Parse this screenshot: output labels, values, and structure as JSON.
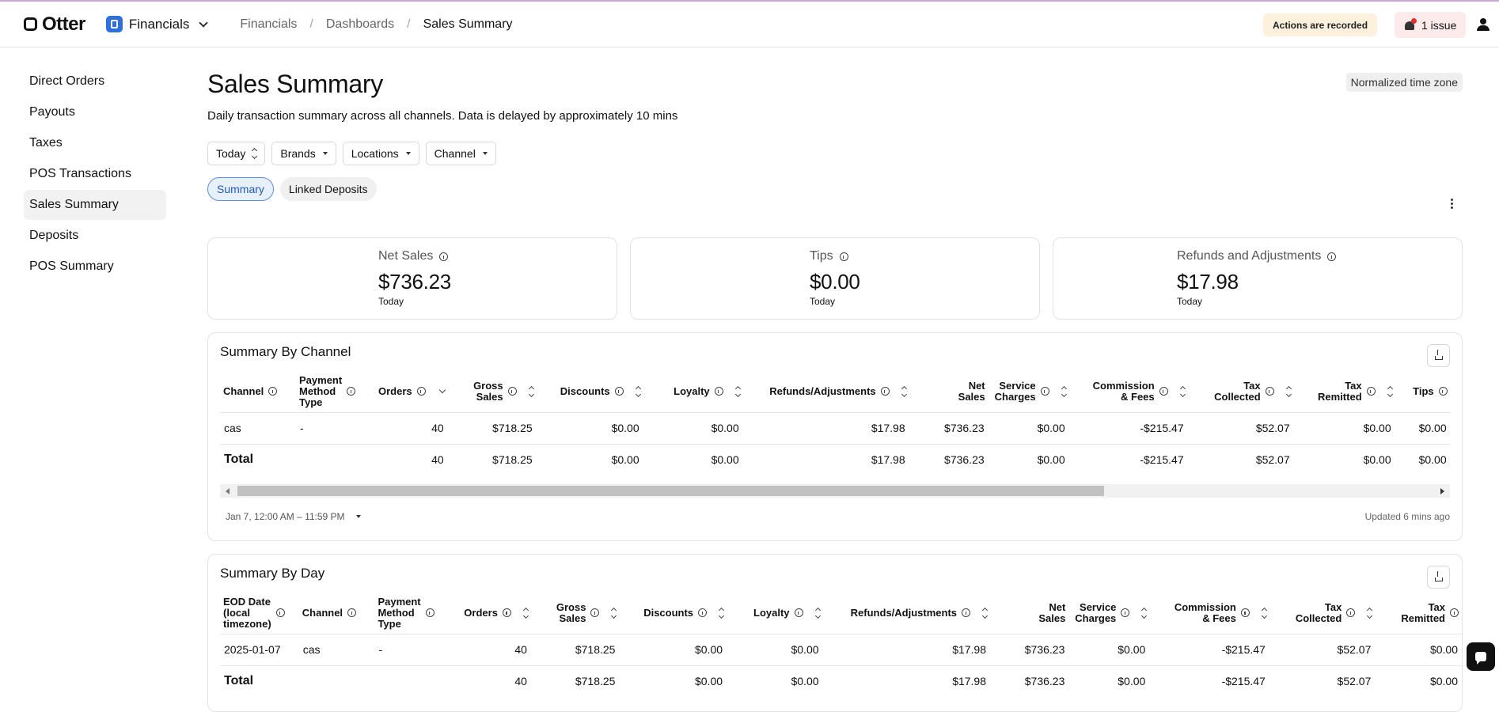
{
  "app": {
    "logo": "Otter",
    "section": "Financials"
  },
  "breadcrumbs": [
    "Financials",
    "/",
    "Dashboards",
    "/",
    "Sales Summary"
  ],
  "header": {
    "recorded": "Actions are recorded",
    "issues": "1 issue"
  },
  "sidebar": {
    "items": [
      {
        "label": "Direct Orders"
      },
      {
        "label": "Payouts"
      },
      {
        "label": "Taxes"
      },
      {
        "label": "POS Transactions"
      },
      {
        "label": "Sales Summary"
      },
      {
        "label": "Deposits"
      },
      {
        "label": "POS Summary"
      }
    ]
  },
  "page": {
    "title": "Sales Summary",
    "subtitle": "Daily transaction summary across all channels. Data is delayed by approximately 10 mins",
    "timezone_badge": "Normalized time zone"
  },
  "filters": {
    "date": "Today",
    "brands": "Brands",
    "locations": "Locations",
    "channel": "Channel"
  },
  "tabs": {
    "summary": "Summary",
    "linked": "Linked Deposits"
  },
  "cards": [
    {
      "label": "Net Sales",
      "value": "$736.23",
      "period": "Today"
    },
    {
      "label": "Tips",
      "value": "$0.00",
      "period": "Today"
    },
    {
      "label": "Refunds and Adjustments",
      "value": "$17.98",
      "period": "Today"
    }
  ],
  "by_channel": {
    "title": "Summary By Channel",
    "headers": {
      "channel": "Channel",
      "pmt1": "Payment",
      "pmt2": "Method",
      "pmt3": "Type",
      "orders": "Orders",
      "gross1": "Gross",
      "gross2": "Sales",
      "discounts": "Discounts",
      "loyalty": "Loyalty",
      "refunds": "Refunds/Adjustments",
      "net1": "Net",
      "net2": "Sales",
      "svc1": "Service",
      "svc2": "Charges",
      "comm1": "Commission",
      "comm2": "& Fees",
      "taxc1": "Tax",
      "taxc2": "Collected",
      "taxr1": "Tax",
      "taxr2": "Remitted",
      "tips": "Tips"
    },
    "row": {
      "channel": "cas",
      "pmt": "-",
      "orders": "40",
      "gross": "$718.25",
      "discounts": "$0.00",
      "loyalty": "$0.00",
      "refunds": "$17.98",
      "net": "$736.23",
      "svc": "$0.00",
      "comm": "-$215.47",
      "taxc": "$52.07",
      "taxr": "$0.00",
      "tips": "$0.00"
    },
    "total": {
      "label": "Total",
      "orders": "40",
      "gross": "$718.25",
      "discounts": "$0.00",
      "loyalty": "$0.00",
      "refunds": "$17.98",
      "net": "$736.23",
      "svc": "$0.00",
      "comm": "-$215.47",
      "taxc": "$52.07",
      "taxr": "$0.00",
      "tips": "$0.00"
    },
    "range": "Jan 7, 12:00 AM – 11:59 PM",
    "updated": "Updated 6 mins ago"
  },
  "by_day": {
    "title": "Summary By Day",
    "headers": {
      "eod1": "EOD Date",
      "eod2": "(local",
      "eod3": "timezone)",
      "channel": "Channel",
      "pmt1": "Payment",
      "pmt2": "Method",
      "pmt3": "Type",
      "orders": "Orders",
      "gross1": "Gross",
      "gross2": "Sales",
      "discounts": "Discounts",
      "loyalty": "Loyalty",
      "refunds": "Refunds/Adjustments",
      "net1": "Net",
      "net2": "Sales",
      "svc1": "Service",
      "svc2": "Charges",
      "comm1": "Commission",
      "comm2": "& Fees",
      "taxc1": "Tax",
      "taxc2": "Collected",
      "taxr1": "Tax",
      "taxr2": "Remitted"
    },
    "row": {
      "date": "2025-01-07",
      "channel": "cas",
      "pmt": "-",
      "orders": "40",
      "gross": "$718.25",
      "discounts": "$0.00",
      "loyalty": "$0.00",
      "refunds": "$17.98",
      "net": "$736.23",
      "svc": "$0.00",
      "comm": "-$215.47",
      "taxc": "$52.07",
      "taxr": "$0.00"
    },
    "total": {
      "label": "Total",
      "orders": "40",
      "gross": "$718.25",
      "discounts": "$0.00",
      "loyalty": "$0.00",
      "refunds": "$17.98",
      "net": "$736.23",
      "svc": "$0.00",
      "comm": "-$215.47",
      "taxc": "$52.07",
      "taxr": "$0.00"
    }
  }
}
